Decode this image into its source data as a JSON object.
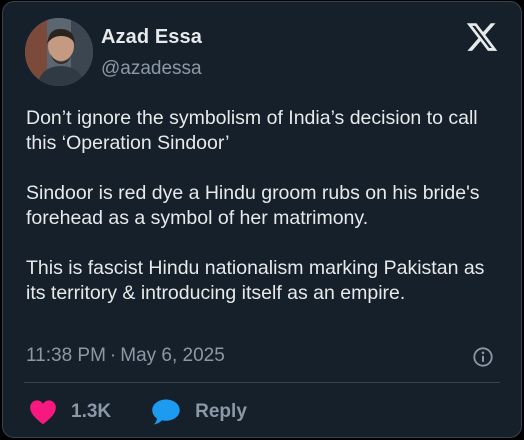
{
  "author": {
    "name": "Azad Essa",
    "handle": "@azadessa",
    "avatar": "profile-photo"
  },
  "tweet": {
    "paragraphs": [
      "Don’t ignore the symbolism of India’s decision to call this ‘Operation Sindoor’",
      "Sindoor is red dye a Hindu groom rubs on his bride's forehead as a symbol of her matrimony.",
      "This is fascist Hindu nationalism marking Pakistan as its territory & introducing itself as an empire."
    ]
  },
  "meta": {
    "time": "11:38 PM",
    "separator": "·",
    "date": "May 6, 2025"
  },
  "actions": {
    "like_count": "1.3K",
    "reply_label": "Reply"
  },
  "icons": {
    "brand": "x-logo-icon",
    "info": "info-icon",
    "like": "heart-icon",
    "reply": "speech-bubble-icon"
  },
  "colors": {
    "background": "#15202b",
    "text": "#e7e9ea",
    "secondary": "#8b98a5",
    "like": "#f91880",
    "reply": "#1d9bf0"
  }
}
